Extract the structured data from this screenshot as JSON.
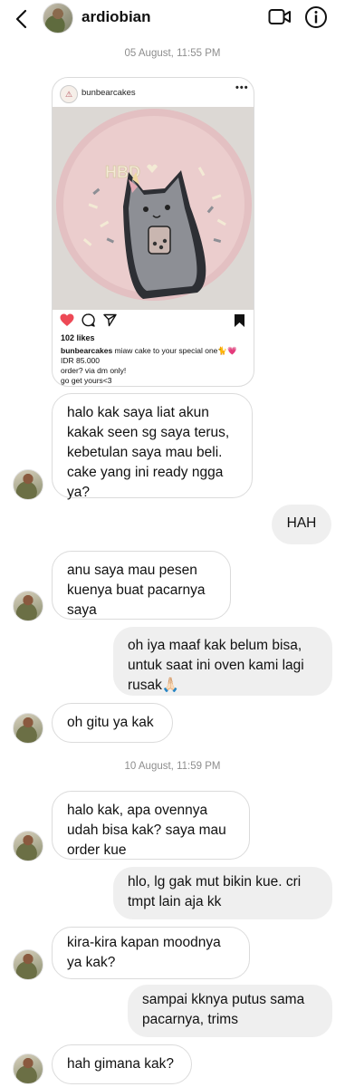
{
  "header": {
    "username": "ardiobian"
  },
  "timestamps": [
    "05 August, 11:55 PM",
    "10 August, 11:59 PM"
  ],
  "post": {
    "username": "bunbearcakes",
    "cake_text": "HBD",
    "likes": "102 likes",
    "caption_user": "bunbearcakes",
    "caption_text": "miaw cake to your special one🐈💗",
    "caption_lines": [
      "IDR 85.000",
      "order? via dm only!",
      "go get yours<3"
    ]
  },
  "messages": [
    {
      "side": "in",
      "text": "halo kak saya liat akun\nkakak seen sg saya terus,\nkebetulan saya mau beli.\ncake yang ini ready ngga\nya?"
    },
    {
      "side": "out",
      "text": "HAH"
    },
    {
      "side": "in",
      "text": "anu saya mau pesen\nkuenya buat pacarnya\nsaya"
    },
    {
      "side": "out",
      "text": "oh iya maaf kak belum bisa,\nuntuk saat ini oven kami lagi\nrusak🙏🏻"
    },
    {
      "side": "in",
      "text": "oh gitu ya kak"
    },
    {
      "side": "in",
      "text": "halo kak, apa ovennya\nudah bisa kak? saya mau\norder kue"
    },
    {
      "side": "out",
      "text": "hlo, lg gak mut bikin kue. cri\ntmpt lain aja kk"
    },
    {
      "side": "in",
      "text": "kira-kira kapan moodnya\nya kak?"
    },
    {
      "side": "out",
      "text": "sampai kknya putus sama\npacarnya, trims"
    },
    {
      "side": "in",
      "text": "hah gimana kak?"
    }
  ],
  "colors": {
    "incoming_border": "#dbdbdb",
    "outgoing_bg": "#efefef",
    "timestamp": "#8e8e8e",
    "like_heart": "#ed4956"
  }
}
